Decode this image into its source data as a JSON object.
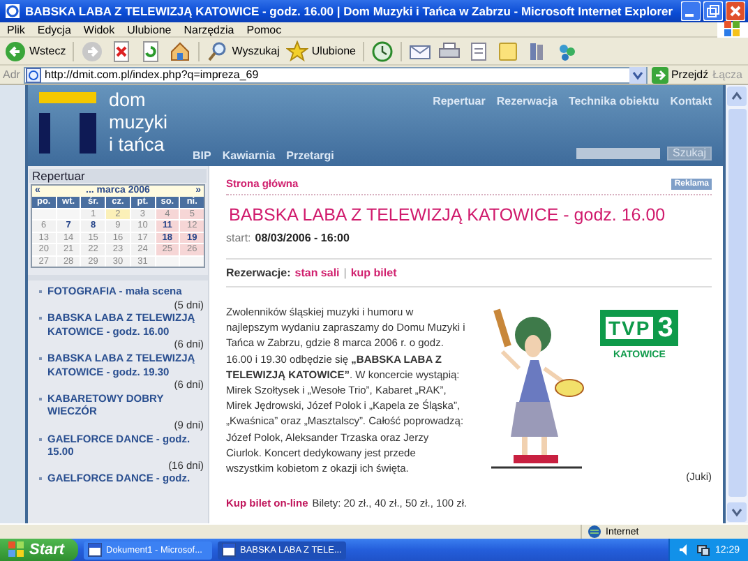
{
  "window": {
    "title": "BABSKA LABA Z TELEWIZJĄ KATOWICE - godz. 16.00 | Dom Muzyki i Tańca w Zabrzu - Microsoft Internet Explorer"
  },
  "menu": [
    "Plik",
    "Edycja",
    "Widok",
    "Ulubione",
    "Narzędzia",
    "Pomoc"
  ],
  "toolbar": [
    {
      "kind": "back",
      "label": "Wstecz"
    },
    {
      "kind": "forward"
    },
    {
      "kind": "stop"
    },
    {
      "kind": "refresh"
    },
    {
      "kind": "home"
    },
    {
      "kind": "search",
      "label": "Wyszukaj"
    },
    {
      "kind": "favorites",
      "label": "Ulubione"
    },
    {
      "kind": "history"
    },
    {
      "kind": "mail"
    },
    {
      "kind": "print"
    },
    {
      "kind": "edit"
    },
    {
      "kind": "note"
    },
    {
      "kind": "research"
    },
    {
      "kind": "messenger"
    }
  ],
  "address_bar": {
    "label": "Adr",
    "url": "http://dmit.com.pl/index.php?q=impreza_69",
    "go": "Przejdź",
    "links": "Łącza"
  },
  "site": {
    "logo": [
      "dom",
      "muzyki",
      "i tańca"
    ],
    "nav": [
      "Repertuar",
      "Rezerwacja",
      "Technika obiektu",
      "Kontakt"
    ],
    "subnav": [
      "BIP",
      "Kawiarnia",
      "Przetargi"
    ],
    "search_button": "Szukaj"
  },
  "sidebar": {
    "title": "Repertuar",
    "calendar": {
      "prev": "«",
      "month": "... marca 2006",
      "next": "»",
      "weekdays": [
        "po.",
        "wt.",
        "śr.",
        "cz.",
        "pt.",
        "so.",
        "ni."
      ],
      "weeks": [
        [
          {
            "kind": "empty"
          },
          {
            "kind": "empty"
          },
          {
            "day": "1",
            "kind": "weekday",
            "event": false
          },
          {
            "day": "2",
            "kind": "today",
            "event": false
          },
          {
            "day": "3",
            "kind": "weekday",
            "event": false
          },
          {
            "day": "4",
            "kind": "weekend",
            "event": false
          },
          {
            "day": "5",
            "kind": "weekend",
            "event": false
          }
        ],
        [
          {
            "day": "6",
            "kind": "weekday",
            "event": false
          },
          {
            "day": "7",
            "kind": "weekday",
            "event": true
          },
          {
            "day": "8",
            "kind": "weekday",
            "event": true
          },
          {
            "day": "9",
            "kind": "weekday",
            "event": false
          },
          {
            "day": "10",
            "kind": "weekday",
            "event": false
          },
          {
            "day": "11",
            "kind": "weekend",
            "event": true
          },
          {
            "day": "12",
            "kind": "weekend",
            "event": false
          }
        ],
        [
          {
            "day": "13",
            "kind": "weekday",
            "event": false
          },
          {
            "day": "14",
            "kind": "weekday",
            "event": false
          },
          {
            "day": "15",
            "kind": "weekday",
            "event": false
          },
          {
            "day": "16",
            "kind": "weekday",
            "event": false
          },
          {
            "day": "17",
            "kind": "weekday",
            "event": false
          },
          {
            "day": "18",
            "kind": "weekend",
            "event": true
          },
          {
            "day": "19",
            "kind": "weekend",
            "event": true
          }
        ],
        [
          {
            "day": "20",
            "kind": "weekday",
            "event": false
          },
          {
            "day": "21",
            "kind": "weekday",
            "event": false
          },
          {
            "day": "22",
            "kind": "weekday",
            "event": false
          },
          {
            "day": "23",
            "kind": "weekday",
            "event": false
          },
          {
            "day": "24",
            "kind": "weekday",
            "event": false
          },
          {
            "day": "25",
            "kind": "weekend",
            "event": false
          },
          {
            "day": "26",
            "kind": "weekend",
            "event": false
          }
        ],
        [
          {
            "day": "27",
            "kind": "weekday",
            "event": false
          },
          {
            "day": "28",
            "kind": "weekday",
            "event": false
          },
          {
            "day": "29",
            "kind": "weekday",
            "event": false
          },
          {
            "day": "30",
            "kind": "weekday",
            "event": false
          },
          {
            "day": "31",
            "kind": "weekday",
            "event": false
          },
          {
            "kind": "empty"
          },
          {
            "kind": "empty"
          }
        ]
      ]
    },
    "events": [
      {
        "title": "FOTOGRAFIA - mała scena",
        "days": "(5 dni)"
      },
      {
        "title": "BABSKA LABA Z TELEWIZJĄ KATOWICE - godz. 16.00",
        "days": "(6 dni)"
      },
      {
        "title": "BABSKA LABA Z TELEWIZJĄ KATOWICE - godz. 19.30",
        "days": "(6 dni)"
      },
      {
        "title": "KABARETOWY DOBRY WIECZÓR",
        "days": "(9 dni)"
      },
      {
        "title": "GAELFORCE DANCE - godz. 15.00",
        "days": "(16 dni)"
      },
      {
        "title": "GAELFORCE DANCE - godz."
      }
    ]
  },
  "content": {
    "breadcrumb": "Strona główna",
    "ad_badge": "Reklama",
    "title": "BABSKA LABA Z TELEWIZJĄ KATOWICE - godz. 16.00",
    "start_label": "start:",
    "start_value": "08/03/2006 - 16:00",
    "reservation_label": "Rezerwacje:",
    "reservation_links": [
      "stan sali",
      "kup bilet"
    ],
    "separator": "|",
    "description": "Zwolenników śląskiej muzyki i humoru w najlepszym wydaniu zapraszamy do Domu Muzyki i Tańca w Zabrzu, gdzie 8 marca 2006 r. o godz. 16.00 i 19.30 odbędzie się **„BABSKA LABA Z TELEWIZJĄ KATOWICE”**. W koncercie wystąpią: Mirek Szołtysek i „Wesołe Trio”, Kabaret „RAK”, Mirek Jędrowski, Józef Polok i „Kapela ze Śląska”, „Kwaśnica” oraz „Masztalscy”. Całość poprowadzą: Józef Polok, Aleksander Trzaska oraz Jerzy Ciurlok. Koncert dedykowany jest przede wszystkim kobietom z okazji ich święta.",
    "logo": {
      "text": "TVP",
      "number": "3",
      "caption": "KATOWICE"
    },
    "author": "(Juki)",
    "buy_link": "Kup bilet on-line",
    "prices": "Bilety: 20 zł., 40 zł., 50 zł., 100 zł."
  },
  "status_bar": {
    "zone": "Internet"
  },
  "taskbar": {
    "start": "Start",
    "tasks": [
      {
        "label": "Dokument1 - Microsof...",
        "selected": false
      },
      {
        "label": "BABSKA LABA Z TELE...",
        "selected": true
      }
    ],
    "clock": "12:29"
  }
}
